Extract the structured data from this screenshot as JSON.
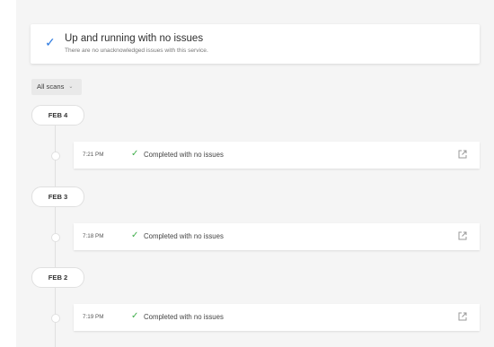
{
  "status": {
    "title": "Up and running with no issues",
    "subtitle": "There are no unacknowledged issues with this service.",
    "icon": "check-icon",
    "accent": "#2f7be0"
  },
  "filter": {
    "label": "All scans",
    "icon": "chevron-down-icon"
  },
  "groups": [
    {
      "date": "FEB 4",
      "scans": [
        {
          "time": "7:21 PM",
          "status": "Completed with no issues"
        }
      ]
    },
    {
      "date": "FEB 3",
      "scans": [
        {
          "time": "7:18 PM",
          "status": "Completed with no issues"
        }
      ]
    },
    {
      "date": "FEB 2",
      "scans": [
        {
          "time": "7:19 PM",
          "status": "Completed with no issues"
        }
      ]
    }
  ],
  "colors": {
    "success": "#3fae4a",
    "background": "#f5f5f5"
  }
}
